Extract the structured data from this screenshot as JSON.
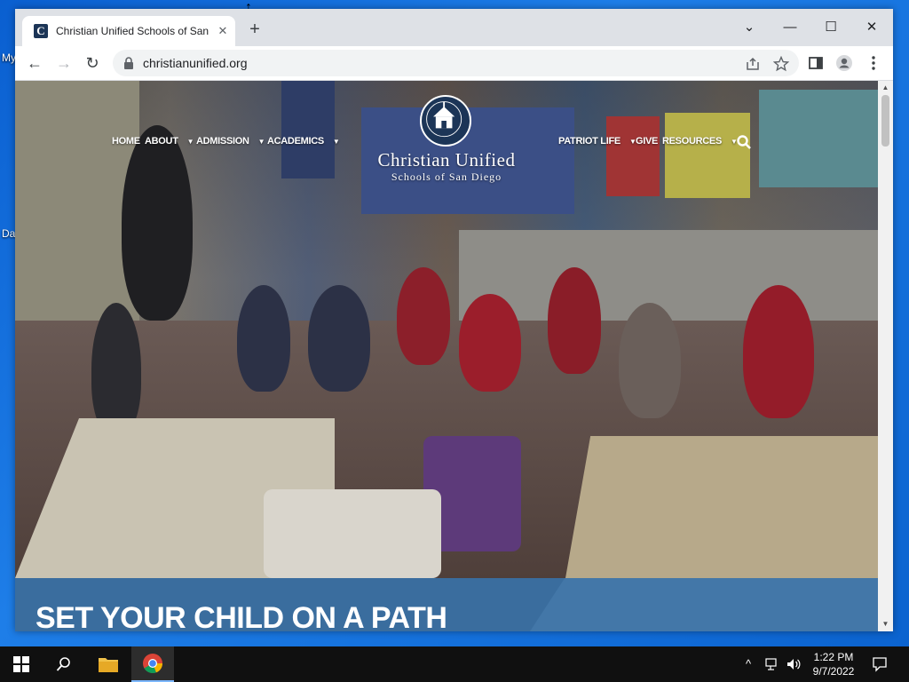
{
  "desktop": {
    "icon_labels": [
      "My",
      "Da"
    ]
  },
  "browser": {
    "tab": {
      "favicon_letter": "C",
      "title": "Christian Unified Schools of San Diego",
      "close_glyph": "✕"
    },
    "newtab_glyph": "+",
    "window_controls": {
      "dropdown": "⌄",
      "minimize": "—",
      "maximize": "☐",
      "close": "✕"
    },
    "toolbar": {
      "back": "←",
      "forward": "→",
      "reload": "↻",
      "url": "christianunified.org"
    }
  },
  "site": {
    "nav_left": [
      {
        "label": "HOME",
        "has_menu": false
      },
      {
        "label": "ABOUT",
        "has_menu": true
      },
      {
        "label": "ADMISSION",
        "has_menu": true
      },
      {
        "label": "ACADEMICS",
        "has_menu": true
      }
    ],
    "nav_right": [
      {
        "label": "PATRIOT LIFE",
        "has_menu": true
      },
      {
        "label": "GIVE",
        "has_menu": false
      },
      {
        "label": "RESOURCES",
        "has_menu": true
      }
    ],
    "caret": "▼",
    "logo_title": "Christian Unified",
    "logo_subtitle": "Schools of San Diego",
    "headline": "SET YOUR CHILD ON A PATH"
  },
  "taskbar": {
    "time": "1:22 PM",
    "date": "9/7/2022",
    "tray_chevron": "^"
  },
  "colors": {
    "band": "#3a6d9e",
    "seal": "#1c3557",
    "taskbar": "#101010"
  }
}
